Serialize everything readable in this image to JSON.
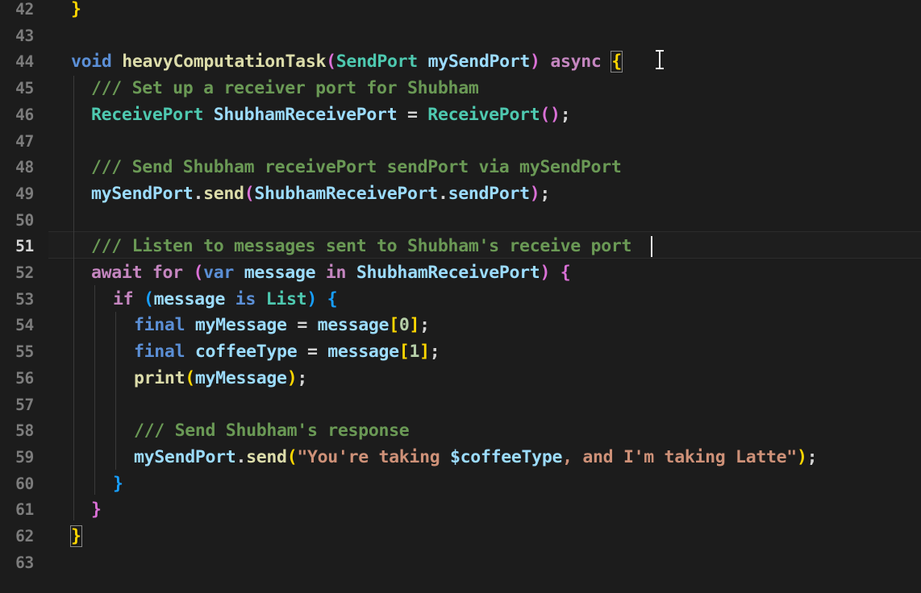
{
  "editor": {
    "active_line": "51",
    "line_numbers": [
      "42",
      "43",
      "44",
      "45",
      "46",
      "47",
      "48",
      "49",
      "50",
      "51",
      "52",
      "53",
      "54",
      "55",
      "56",
      "57",
      "58",
      "59",
      "60",
      "61",
      "62",
      "63"
    ]
  },
  "code": {
    "l42": {
      "brace": "}"
    },
    "l44": {
      "void": "void",
      "name": "heavyComputationTask",
      "lp": "(",
      "type": "SendPort",
      "param": "mySendPort",
      "rp": ")",
      "async": "async",
      "brace": "{"
    },
    "l45": {
      "comment": "/// Set up a receiver port for Shubham"
    },
    "l46": {
      "type": "ReceivePort",
      "name": "ShubhamReceivePort",
      "eq": " = ",
      "ctor": "ReceivePort",
      "parens": "()",
      "semi": ";"
    },
    "l48": {
      "comment": "/// Send Shubham receivePort sendPort via mySendPort"
    },
    "l49": {
      "obj": "mySendPort",
      "dot": ".",
      "method": "send",
      "lp": "(",
      "arg": "ShubhamReceivePort",
      "dot2": ".",
      "prop": "sendPort",
      "rp": ")",
      "semi": ";"
    },
    "l51": {
      "comment": "/// Listen to messages sent to Shubham's receive port"
    },
    "l52": {
      "await": "await",
      "for": "for",
      "lp": "(",
      "var": "var",
      "message": "message",
      "in": "in",
      "source": "ShubhamReceivePort",
      "rp": ")",
      "brace": "{"
    },
    "l53": {
      "if": "if",
      "lp": "(",
      "message": "message",
      "is": "is",
      "type": "List",
      "rp": ")",
      "brace": "{"
    },
    "l54": {
      "final": "final",
      "name": "myMessage",
      "eq": " = ",
      "source": "message",
      "lb": "[",
      "index": "0",
      "rb": "]",
      "semi": ";"
    },
    "l55": {
      "final": "final",
      "name": "coffeeType",
      "eq": " = ",
      "source": "message",
      "lb": "[",
      "index": "1",
      "rb": "]",
      "semi": ";"
    },
    "l56": {
      "fn": "print",
      "lp": "(",
      "arg": "myMessage",
      "rp": ")",
      "semi": ";"
    },
    "l58": {
      "comment": "/// Send Shubham's response"
    },
    "l59": {
      "obj": "mySendPort",
      "dot": ".",
      "method": "send",
      "lp": "(",
      "str1": "\"You're taking ",
      "interp": "$coffeeType",
      "str2": ", and I'm taking Latte\"",
      "rp": ")",
      "semi": ";"
    },
    "l60": {
      "brace": "}"
    },
    "l61": {
      "brace": "}"
    },
    "l62": {
      "brace": "}"
    }
  }
}
